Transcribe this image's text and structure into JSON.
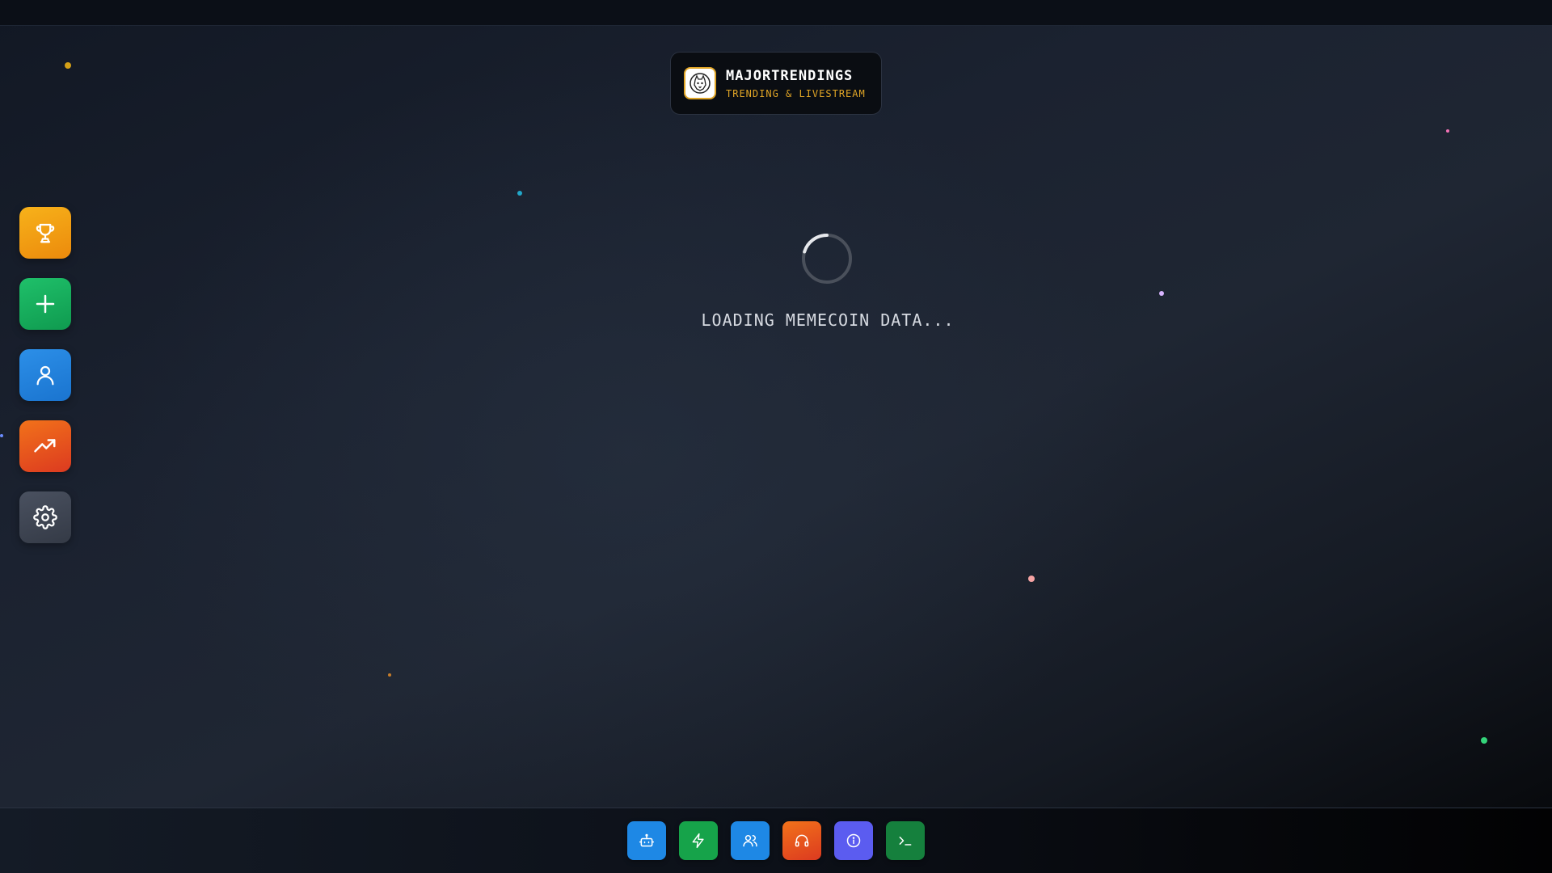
{
  "brand": {
    "title": "MAJORTRENDINGS",
    "subtitle": "TRENDING & LIVESTREAM",
    "logo_icon": "wolf-logo-icon",
    "accent_color": "#e0a526"
  },
  "status": {
    "loading_text": "LOADING MEMECOIN DATA..."
  },
  "sidebar": {
    "items": [
      {
        "icon": "trophy-icon",
        "color": "#f59e0b"
      },
      {
        "icon": "plus-icon",
        "color": "#16a34a"
      },
      {
        "icon": "user-icon",
        "color": "#1d8ce0"
      },
      {
        "icon": "trending-up-icon",
        "color": "#ea580c"
      },
      {
        "icon": "gear-icon",
        "color": "#3f4654"
      }
    ]
  },
  "dock": {
    "items": [
      {
        "icon": "bot-icon",
        "color": "#1e88e5"
      },
      {
        "icon": "lightning-icon",
        "color": "#16a34a"
      },
      {
        "icon": "users-icon",
        "color": "#1e88e5"
      },
      {
        "icon": "headphones-icon",
        "color": "#ea580c"
      },
      {
        "icon": "info-icon",
        "color": "#5b5cf0"
      },
      {
        "icon": "terminal-icon",
        "color": "#15803d"
      }
    ]
  }
}
